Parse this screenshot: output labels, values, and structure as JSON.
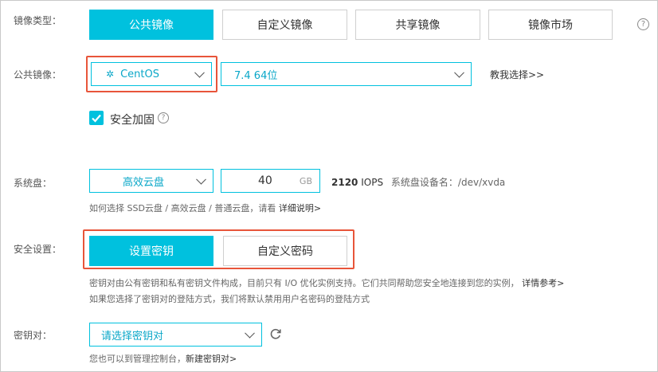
{
  "image_type": {
    "label": "镜像类型：",
    "options": [
      "公共镜像",
      "自定义镜像",
      "共享镜像",
      "镜像市场"
    ],
    "active_index": 0
  },
  "public_image": {
    "label": "公共镜像：",
    "os": "CentOS",
    "version": "7.4 64位",
    "help_link": "教我选择>>"
  },
  "security_harden": {
    "label": "安全加固",
    "checked": true
  },
  "system_disk": {
    "label": "系统盘：",
    "type": "高效云盘",
    "size": "40",
    "unit": "GB",
    "iops": "2120",
    "iops_unit": "IOPS",
    "device_prefix": "系统盘设备名：",
    "device_name": "/dev/xvda",
    "hint_prefix": "如何选择 SSD云盘 / 高效云盘 / 普通云盘，请看",
    "hint_link": "详细说明>"
  },
  "security_settings": {
    "label": "安全设置：",
    "options": [
      "设置密钥",
      "自定义密码"
    ],
    "active_index": 0,
    "desc_line1": "密钥对由公有密钥和私有密钥文件构成，目前只有 I/O 优化实例支持。它们共同帮助您安全地连接到您的实例，",
    "desc_link": "详情参考>",
    "desc_line2": "如果您选择了密钥对的登陆方式，我们将默认禁用用户名密码的登陆方式"
  },
  "key_pair": {
    "label": "密钥对：",
    "placeholder": "请选择密钥对",
    "hint_prefix": "您也可以到管理控制台，",
    "hint_link": "新建密钥对>"
  },
  "colors": {
    "accent": "#00c1de",
    "highlight": "#e8553a"
  }
}
